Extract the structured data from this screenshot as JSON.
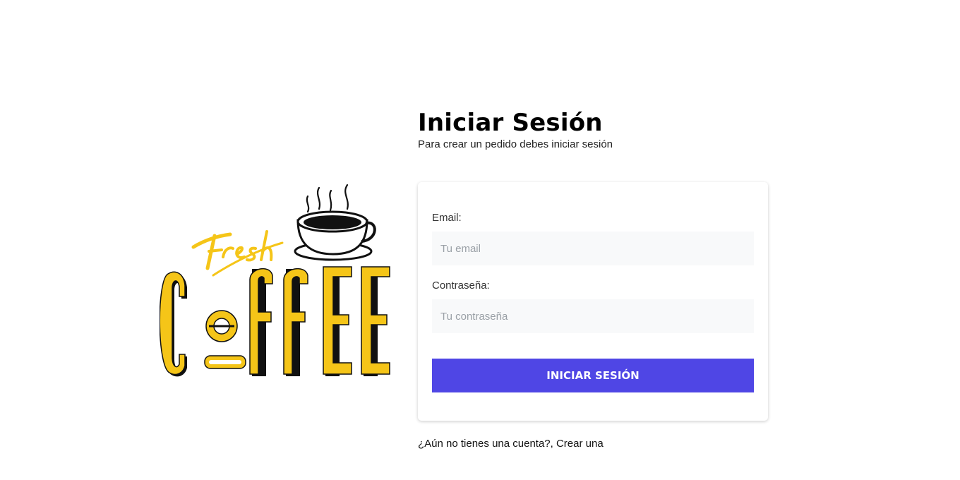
{
  "header": {
    "title": "Iniciar Sesión",
    "subtitle": "Para crear un pedido debes iniciar sesión"
  },
  "logo": {
    "text_top": "Fresh",
    "text_main": "COFFEE",
    "colors": {
      "yellow": "#f5c518",
      "ink": "#111111"
    }
  },
  "form": {
    "email_label": "Email:",
    "email_placeholder": "Tu email",
    "email_value": "",
    "password_label": "Contraseña:",
    "password_placeholder": "Tu contraseña",
    "password_value": "",
    "submit_label": "Iniciar Sesión"
  },
  "footer": {
    "signup_link": "¿Aún no tienes una cuenta?, Crear una"
  },
  "theme": {
    "accent": "#4f46e5",
    "input_bg": "#f8f9fa"
  }
}
